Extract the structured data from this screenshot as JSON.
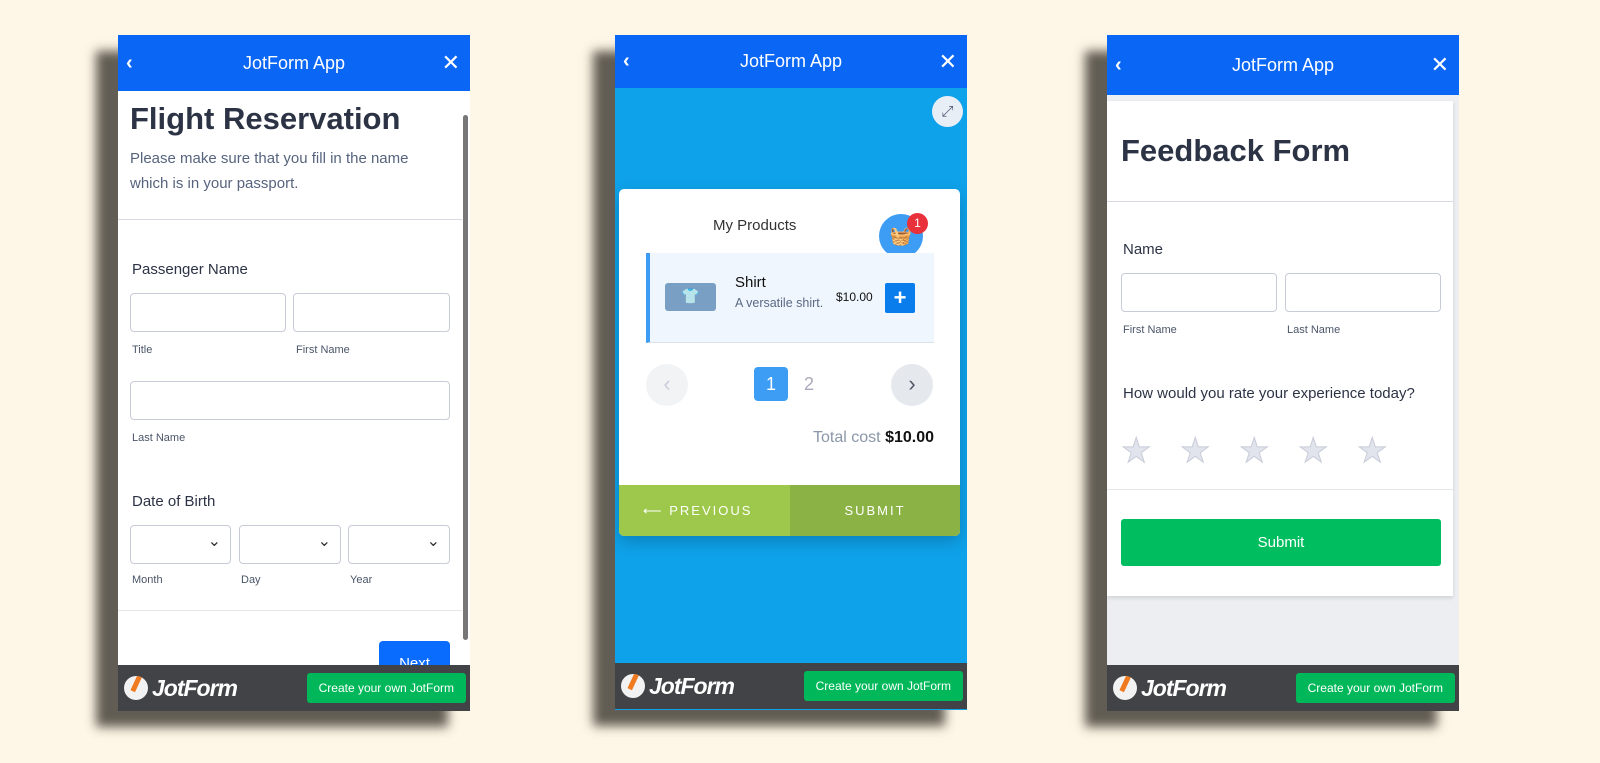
{
  "app_title": "JotForm App",
  "footer": {
    "logo": "JotForm",
    "cta": "Create your own JotForm"
  },
  "flight": {
    "title": "Flight Reservation",
    "subtitle": "Please make sure that you fill in the name which is in your passport.",
    "passenger_label": "Passenger Name",
    "title_sub": "Title",
    "first_sub": "First Name",
    "last_sub": "Last Name",
    "dob_label": "Date of Birth",
    "month": "Month",
    "day": "Day",
    "year": "Year",
    "next": "Next"
  },
  "products": {
    "heading": "My Products",
    "cart_count": "1",
    "item": {
      "name": "Shirt",
      "desc": "A versatile shirt.",
      "price": "$10.00"
    },
    "pages": [
      "1",
      "2"
    ],
    "total_label": "Total cost",
    "total_value": "$10.00",
    "previous": "PREVIOUS",
    "submit": "SUBMIT"
  },
  "feedback": {
    "title": "Feedback Form",
    "name_label": "Name",
    "first_sub": "First Name",
    "last_sub": "Last Name",
    "rating_q": "How would you rate your experience today?",
    "rating": 0,
    "rating_max": 5,
    "submit": "Submit"
  }
}
